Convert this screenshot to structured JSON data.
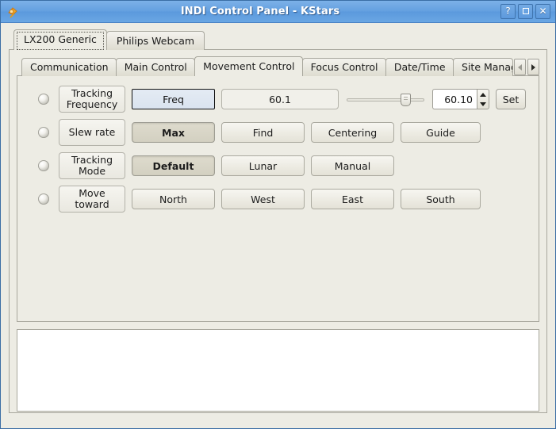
{
  "window": {
    "title": "INDI Control Panel - KStars",
    "icon": "indi-telescope-icon",
    "buttons": {
      "help": "?",
      "maximize": "",
      "close": "✕"
    }
  },
  "device_tabs": [
    {
      "label": "LX200 Generic",
      "selected": true
    },
    {
      "label": "Philips Webcam",
      "selected": false
    }
  ],
  "group_tabs": [
    {
      "label": "Communication",
      "selected": false
    },
    {
      "label": "Main Control",
      "selected": false
    },
    {
      "label": "Movement Control",
      "selected": true
    },
    {
      "label": "Focus Control",
      "selected": false
    },
    {
      "label": "Date/Time",
      "selected": false
    },
    {
      "label": "Site Manage",
      "selected": false
    }
  ],
  "tab_scroll": {
    "left": "◄",
    "right": "►"
  },
  "properties": [
    {
      "name": "Tracking Frequency",
      "label": "Tracking\nFrequency",
      "state_led": "idle",
      "type": "number",
      "toggle": {
        "label": "Freq",
        "focused": true
      },
      "value_display": "60.1",
      "slider": {
        "position_pct": 80
      },
      "spinbox": {
        "value": "60.10"
      },
      "set_label": "Set"
    },
    {
      "name": "Slew rate",
      "label": "Slew rate",
      "state_led": "idle",
      "type": "switch",
      "options": [
        {
          "label": "Max",
          "on": true
        },
        {
          "label": "Find",
          "on": false
        },
        {
          "label": "Centering",
          "on": false
        },
        {
          "label": "Guide",
          "on": false
        }
      ]
    },
    {
      "name": "Tracking Mode",
      "label": "Tracking\nMode",
      "state_led": "idle",
      "type": "switch",
      "options": [
        {
          "label": "Default",
          "on": true
        },
        {
          "label": "Lunar",
          "on": false
        },
        {
          "label": "Manual",
          "on": false
        }
      ]
    },
    {
      "name": "Move toward",
      "label": "Move\ntoward",
      "state_led": "idle",
      "type": "switch",
      "options": [
        {
          "label": "North",
          "on": false
        },
        {
          "label": "West",
          "on": false
        },
        {
          "label": "East",
          "on": false
        },
        {
          "label": "South",
          "on": false
        }
      ]
    }
  ],
  "log": {
    "content": ""
  },
  "colors": {
    "titlebar": "#64a0e0",
    "window_bg": "#edece4",
    "focus_field": "#dae3ef",
    "pressed_button": "#d6d3c5",
    "log_bg": "#ffffff"
  }
}
